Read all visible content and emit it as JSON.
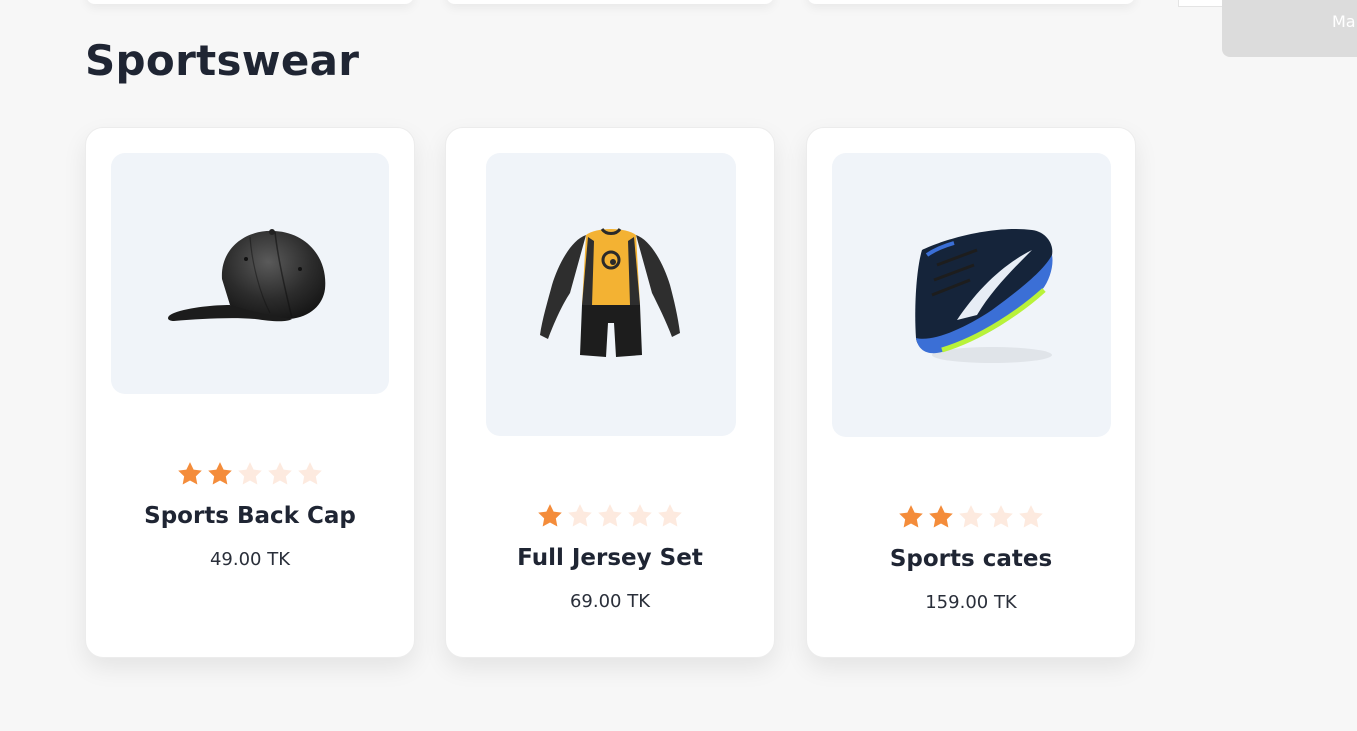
{
  "section": {
    "title": "Sportswear"
  },
  "top_button": {
    "label": "Ma"
  },
  "rating_colors": {
    "filled": "#f48c3a",
    "empty": "#fdeadf"
  },
  "products": [
    {
      "name": "Sports Back Cap",
      "price": "49.00 TK",
      "rating": 2,
      "max_rating": 5,
      "image_icon": "baseball-cap-image"
    },
    {
      "name": "Full Jersey Set",
      "price": "69.00 TK",
      "rating": 1,
      "max_rating": 5,
      "image_icon": "cycling-jersey-image"
    },
    {
      "name": "Sports cates",
      "price": "159.00 TK",
      "rating": 2,
      "max_rating": 5,
      "image_icon": "running-shoe-image"
    }
  ]
}
